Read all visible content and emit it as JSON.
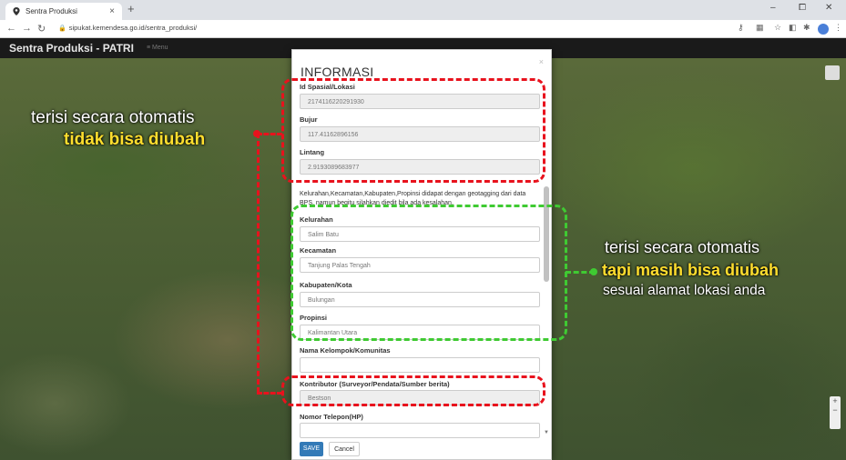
{
  "browser": {
    "tab_title": "Sentra Produksi",
    "tab_close": "×",
    "new_tab": "+",
    "url": "sipukat.kemendesa.go.id/sentra_produksi/",
    "window_controls": [
      "–",
      "⧠",
      "✕"
    ]
  },
  "app": {
    "brand": "Sentra Produksi - PATRI",
    "menu_label": "≡ Menu"
  },
  "modal": {
    "title": "INFORMASI",
    "close": "×",
    "fields": {
      "id_spasial": {
        "label": "Id Spasial/Lokasi",
        "value": "2174116220291930"
      },
      "bujur": {
        "label": "Bujur",
        "value": "117.41162896156"
      },
      "lintang": {
        "label": "Lintang",
        "value": "2.9193089683977"
      },
      "kelurahan": {
        "label": "Kelurahan",
        "value": "Salim Batu"
      },
      "kecamatan": {
        "label": "Kecamatan",
        "value": "Tanjung Palas Tengah"
      },
      "kabupaten": {
        "label": "Kabupaten/Kota",
        "value": "Bulungan"
      },
      "propinsi": {
        "label": "Propinsi",
        "value": "Kalimantan Utara"
      },
      "kelompok": {
        "label": "Nama Kelompok/Komunitas",
        "value": ""
      },
      "kontributor": {
        "label": "Kontributor (Surveyor/Pendata/Sumber berita)",
        "value": "Bestson"
      },
      "telepon": {
        "label": "Nomor Telepon(HP)",
        "value": ""
      }
    },
    "note": "Kelurahan,Kecamatan,Kabupaten,Propinsi didapat dengan geotagging dari data BPS, namun begitu silahkan diedit bila ada kesalahan.",
    "save_label": "SAVE",
    "cancel_label": "Cancel"
  },
  "annotations": {
    "left_line1": "terisi secara otomatis",
    "left_line2": "tidak bisa diubah",
    "right_line1": "terisi secara otomatis",
    "right_line2": "tapi masih bisa diubah",
    "right_line3": "sesuai alamat lokasi anda"
  },
  "colors": {
    "red_annotation": "#e8121d",
    "green_annotation": "#3fca32",
    "highlight_text": "#ffde2e",
    "save_button": "#337ab7"
  }
}
